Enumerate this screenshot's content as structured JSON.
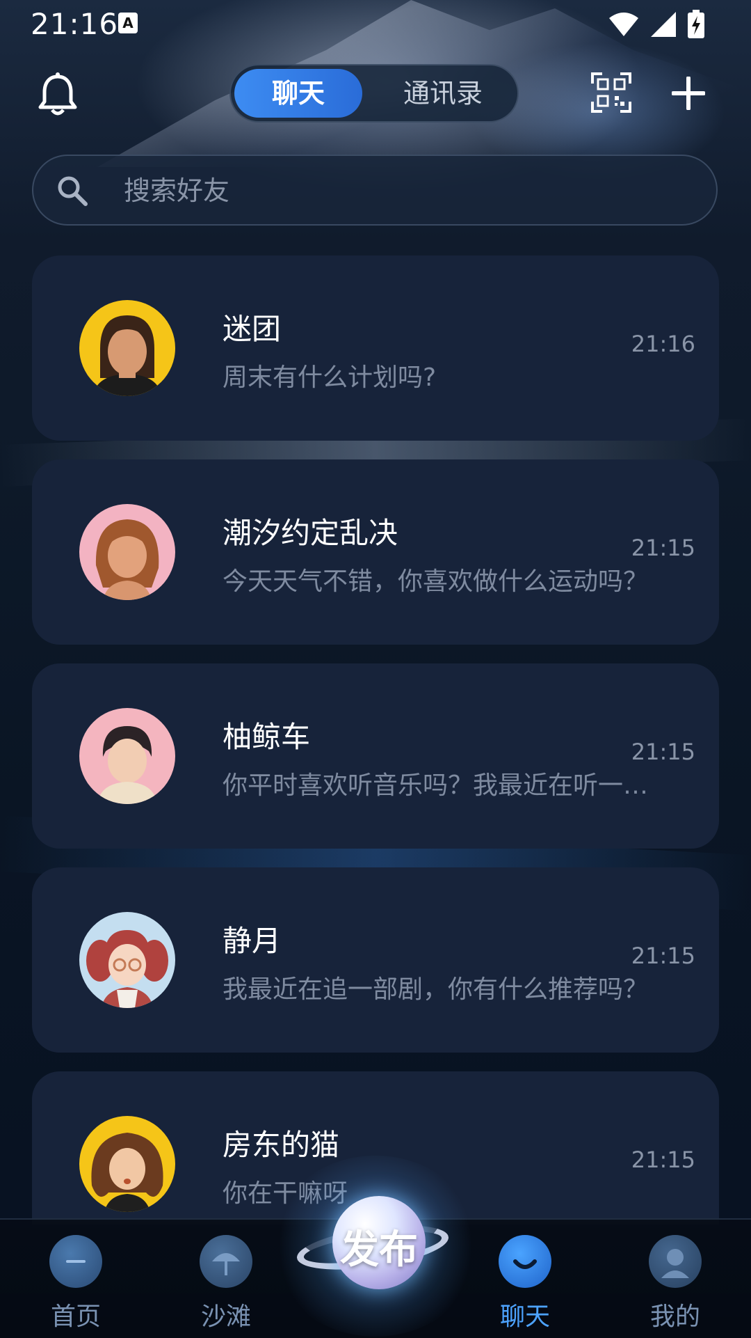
{
  "status_bar": {
    "time": "21:16",
    "notification_icon": "a-letter-icon",
    "icons": [
      "wifi-icon",
      "signal-icon",
      "battery-charging-icon"
    ]
  },
  "header": {
    "bell_icon": "bell-icon",
    "tabs": [
      {
        "label": "聊天",
        "active": true
      },
      {
        "label": "通讯录",
        "active": false
      }
    ],
    "scan_icon": "qr-scan-icon",
    "add_icon": "plus-icon"
  },
  "search": {
    "placeholder": "搜索好友"
  },
  "chats": [
    {
      "name": "迷团",
      "message": "周末有什么计划吗?",
      "time": "21:16",
      "avatar_bg": "#f5c518"
    },
    {
      "name": "潮汐约定乱决",
      "message": "今天天气不错，你喜欢做什么运动吗？",
      "time": "21:15",
      "avatar_bg": "#f3b3c2"
    },
    {
      "name": "柚鲸车",
      "message": "你平时喜欢听音乐吗？我最近在听一首歌",
      "time": "21:15",
      "avatar_bg": "#f4b5bf"
    },
    {
      "name": "静月",
      "message": "我最近在追一部剧，你有什么推荐吗？",
      "time": "21:15",
      "avatar_bg": "#c4def0"
    },
    {
      "name": "房东的猫",
      "message": "你在干嘛呀",
      "time": "21:15",
      "avatar_bg": "#f5c518"
    }
  ],
  "bottom_nav": {
    "items": [
      {
        "label": "首页",
        "active": false
      },
      {
        "label": "沙滩",
        "active": false
      },
      {
        "label": "聊天",
        "active": true
      },
      {
        "label": "我的",
        "active": false
      }
    ],
    "publish_label": "发布"
  },
  "colors": {
    "accent": "#3d8cf2",
    "nav_active": "#4da3ff",
    "card_bg": "#17233a"
  }
}
